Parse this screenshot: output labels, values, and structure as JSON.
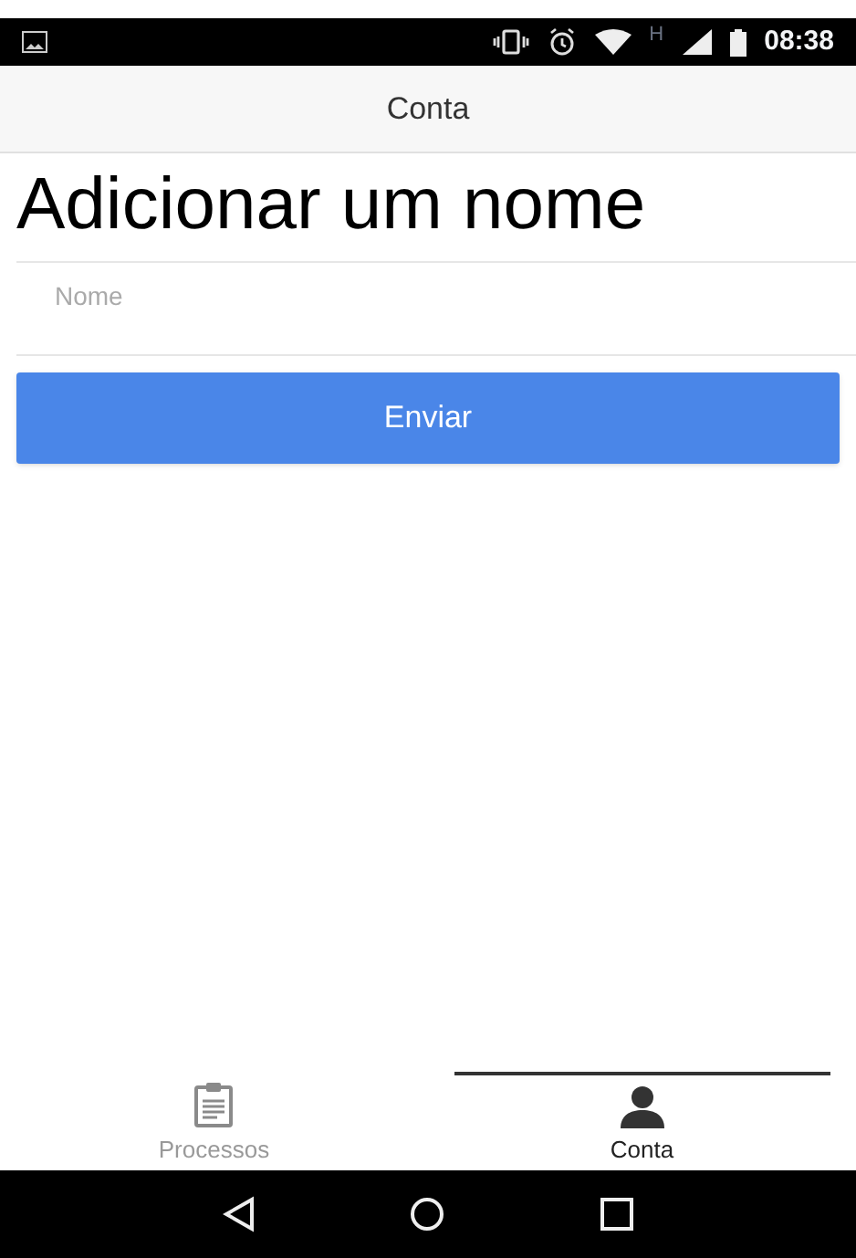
{
  "status_bar": {
    "time": "08:38",
    "network": "H"
  },
  "header": {
    "title": "Conta"
  },
  "page": {
    "title": "Adicionar um nome"
  },
  "name_field": {
    "placeholder": "Nome"
  },
  "submit_button": {
    "label": "Enviar"
  },
  "tabs": [
    {
      "label": "Processos",
      "kind": "clipboard",
      "selected": false
    },
    {
      "label": "Conta",
      "kind": "person",
      "selected": true
    }
  ]
}
